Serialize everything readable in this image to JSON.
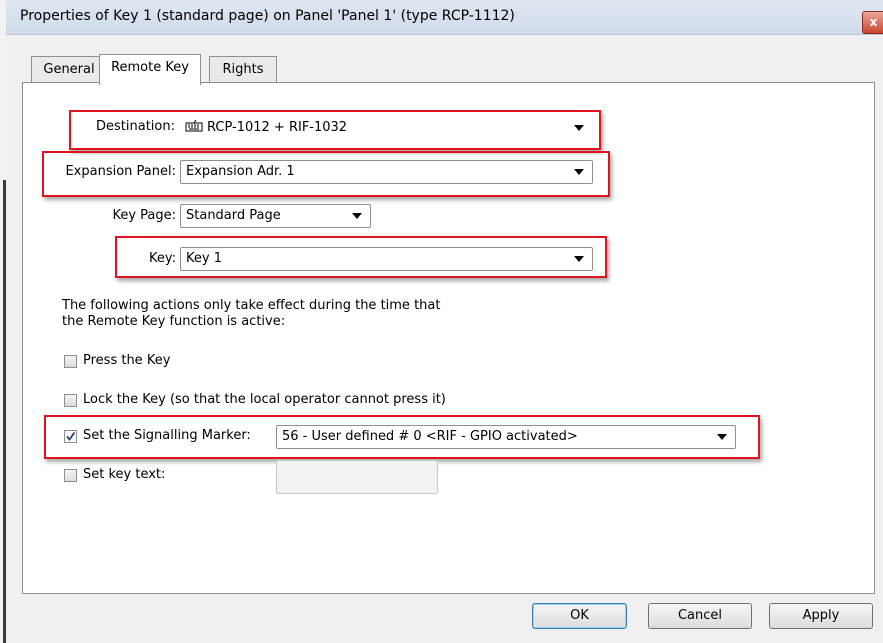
{
  "window": {
    "title": "Properties of Key 1 (standard page) on Panel 'Panel 1' (type RCP-1112)",
    "close_label": "x"
  },
  "tabs": [
    {
      "label": "General",
      "active": false
    },
    {
      "label": "Remote Key",
      "active": true
    },
    {
      "label": "Rights",
      "active": false
    }
  ],
  "form": {
    "destination_label": "Destination:",
    "destination_value": "RCP-1012 + RIF-1032",
    "destination_icon": "keyboard-icon",
    "expansion_label": "Expansion Panel:",
    "expansion_value": "Expansion Adr. 1",
    "keypage_label": "Key Page:",
    "keypage_value": "Standard Page",
    "key_label": "Key:",
    "key_value": "Key 1",
    "info_line1": "The following actions only take effect during the time that",
    "info_line2": "the Remote Key function is active:"
  },
  "options": {
    "press_key": {
      "label": "Press the Key",
      "checked": false
    },
    "lock_key": {
      "label": "Lock the Key (so that the local operator cannot press it)",
      "checked": false
    },
    "signalling": {
      "label": "Set the Signalling Marker:",
      "checked": true,
      "value": "56 - User defined # 0 <RIF - GPIO activated>"
    },
    "key_text": {
      "label": "Set key text:",
      "checked": false,
      "value": ""
    }
  },
  "buttons": {
    "ok": "OK",
    "cancel": "Cancel",
    "apply": "Apply"
  },
  "colors": {
    "highlight": "#e0141e",
    "default_button_border": "#3c7fb1"
  }
}
